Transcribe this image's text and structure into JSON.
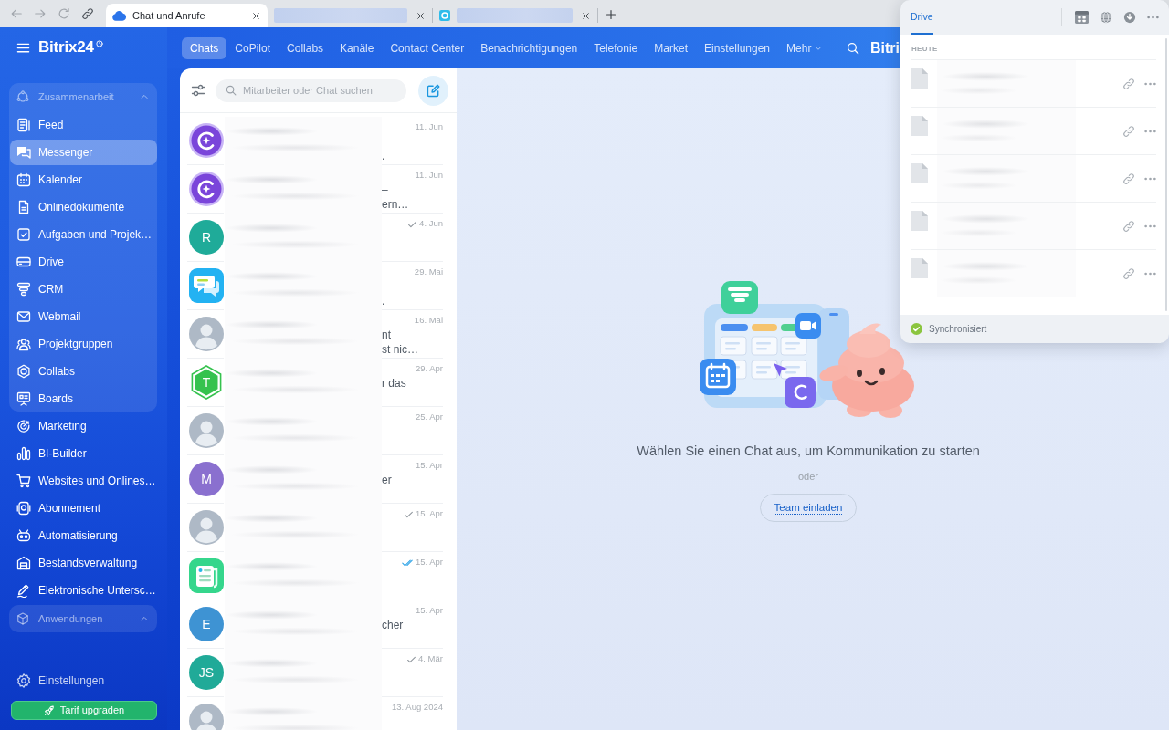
{
  "browser": {
    "tabs": [
      {
        "favicon": {
          "kind": "logo"
        },
        "title": "Chat und Anrufe",
        "selected": true
      },
      {
        "title_blurred": true,
        "selected": false
      },
      {
        "favicon": {
          "kind": "app"
        },
        "title_blurred": true,
        "selected": false
      }
    ]
  },
  "sidebar": {
    "logo": "Bitrix24",
    "sections": [
      {
        "kind": "group",
        "title": "Zusammenarbeit",
        "expanded": true,
        "items": [
          {
            "label": "Feed",
            "selected": false
          },
          {
            "label": "Messenger",
            "selected": true
          },
          {
            "label": "Kalender",
            "selected": false
          },
          {
            "label": "Onlinedokumente",
            "selected": false
          },
          {
            "label": "Aufgaben und Projek…",
            "selected": false
          },
          {
            "label": "Drive",
            "selected": false
          },
          {
            "label": "CRM",
            "selected": false
          },
          {
            "label": "Webmail",
            "selected": false
          },
          {
            "label": "Projektgruppen",
            "selected": false
          },
          {
            "label": "Collabs",
            "selected": false
          },
          {
            "label": "Boards",
            "selected": false
          }
        ]
      },
      {
        "kind": "item",
        "label": "Marketing",
        "selected": false
      },
      {
        "kind": "item",
        "label": "BI-Builder",
        "selected": false
      },
      {
        "kind": "item",
        "label": "Websites und Onlines…",
        "selected": false
      },
      {
        "kind": "item",
        "label": "Abonnement",
        "selected": false
      },
      {
        "kind": "item",
        "label": "Automatisierung",
        "selected": false
      },
      {
        "kind": "item",
        "label": "Bestandsverwaltung",
        "selected": false
      },
      {
        "kind": "item",
        "label": "Elektronische Untersc…",
        "selected": false
      },
      {
        "kind": "group",
        "title": "Anwendungen",
        "expanded": true
      }
    ],
    "settings_item": "Einstellungen",
    "upgrade_button": "Tarif upgraden"
  },
  "topnav": {
    "items": [
      {
        "kind": "link",
        "label": "Chats",
        "selected": true
      },
      {
        "kind": "link",
        "label": "CoPilot",
        "selected": false
      },
      {
        "kind": "link",
        "label": "Collabs",
        "selected": false
      },
      {
        "kind": "link",
        "label": "Kanäle",
        "selected": false
      },
      {
        "kind": "link",
        "label": "Contact Center",
        "selected": false
      },
      {
        "kind": "link",
        "label": "Benachrichtigungen",
        "selected": false
      },
      {
        "kind": "link",
        "label": "Telefonie",
        "selected": false
      },
      {
        "kind": "link",
        "label": "Market",
        "selected": false
      },
      {
        "kind": "link",
        "label": "Einstellungen",
        "selected": false
      },
      {
        "kind": "menu",
        "label": "Mehr",
        "selected": false
      }
    ],
    "brand": "Bitri"
  },
  "chat_list": {
    "search_placeholder": "Mitarbeiter oder Chat suchen",
    "chats": [
      {
        "avatar": {
          "kind": "copilot"
        },
        "blurred": true,
        "date": "11. Jun",
        "preview_line_2": "."
      },
      {
        "avatar": {
          "kind": "copilot"
        },
        "blurred": true,
        "date": "11. Jun",
        "preview_line_1": "–",
        "preview_line_2": "ern…"
      },
      {
        "avatar": {
          "kind": "initials",
          "text": "R",
          "color": "#1fab99"
        },
        "blurred": true,
        "date": "4. Jun",
        "sent": true
      },
      {
        "avatar": {
          "kind": "chatapp"
        },
        "blurred": true,
        "date": "29. Mai",
        "preview_line_2": "."
      },
      {
        "avatar": {
          "kind": "photo"
        },
        "blurred": true,
        "date": "16. Mai",
        "preview_line_1": "nt",
        "preview_line_2": "st nic…"
      },
      {
        "avatar": {
          "kind": "hexagon",
          "text": "T",
          "color": "#35c24e"
        },
        "blurred": true,
        "date": "29. Apr",
        "preview_line_1": "r das"
      },
      {
        "avatar": {
          "kind": "photo"
        },
        "blurred": true,
        "date": "25. Apr"
      },
      {
        "avatar": {
          "kind": "initials",
          "text": "M",
          "color": "#8a70cf"
        },
        "blurred": true,
        "date": "15. Apr",
        "preview_line_1": "er"
      },
      {
        "avatar": {
          "kind": "photo"
        },
        "blurred": true,
        "date": "15. Apr",
        "sent": true
      },
      {
        "avatar": {
          "kind": "newsapp"
        },
        "blurred": true,
        "date": "15. Apr",
        "read": true
      },
      {
        "avatar": {
          "kind": "initials",
          "text": "E",
          "color": "#3e93d3"
        },
        "blurred": true,
        "date": "15. Apr",
        "preview_line_1": "cher"
      },
      {
        "avatar": {
          "kind": "initials",
          "text": "JS",
          "color": "#20aa98"
        },
        "blurred": true,
        "date": "4. Mär",
        "sent": true
      },
      {
        "avatar": {
          "kind": "photo"
        },
        "blurred": true,
        "date": "13. Aug 2024"
      }
    ]
  },
  "empty_state": {
    "message": "Wählen Sie einen Chat aus, um Kommunikation zu starten",
    "separator": "oder",
    "invite_button": "Team einladen"
  },
  "drive_panel": {
    "tabs": [
      {
        "label": "Drive",
        "selected": true
      }
    ],
    "section": "HEUTE",
    "files": [
      {
        "blurred": true
      },
      {
        "blurred": true
      },
      {
        "blurred": true
      },
      {
        "blurred": true
      },
      {
        "blurred": true
      }
    ],
    "status": {
      "label": "Synchronisiert",
      "synced": true
    }
  }
}
